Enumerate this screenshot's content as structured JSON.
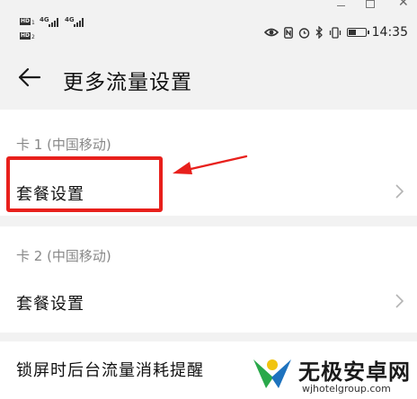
{
  "status_bar": {
    "sim_badge": "HD",
    "sim_1_index": "1",
    "sim_2_index": "2",
    "network_1": "4G",
    "network_2": "4G",
    "time": "14:35",
    "battery_level": 0.45
  },
  "header": {
    "title": "更多流量设置"
  },
  "sim1": {
    "section_label": "卡 1 (中国移动)",
    "plan_settings_label": "套餐设置"
  },
  "sim2": {
    "section_label": "卡 2 (中国移动)",
    "plan_settings_label": "套餐设置"
  },
  "lockscreen": {
    "label": "锁屏时后台流量消耗提醒"
  },
  "watermark": {
    "name": "无极安卓网",
    "url": "wjhotelgroup.com"
  },
  "colors": {
    "highlight": "#e8201c",
    "watermark_green": "#2aa84a",
    "watermark_blue": "#1e73be"
  }
}
